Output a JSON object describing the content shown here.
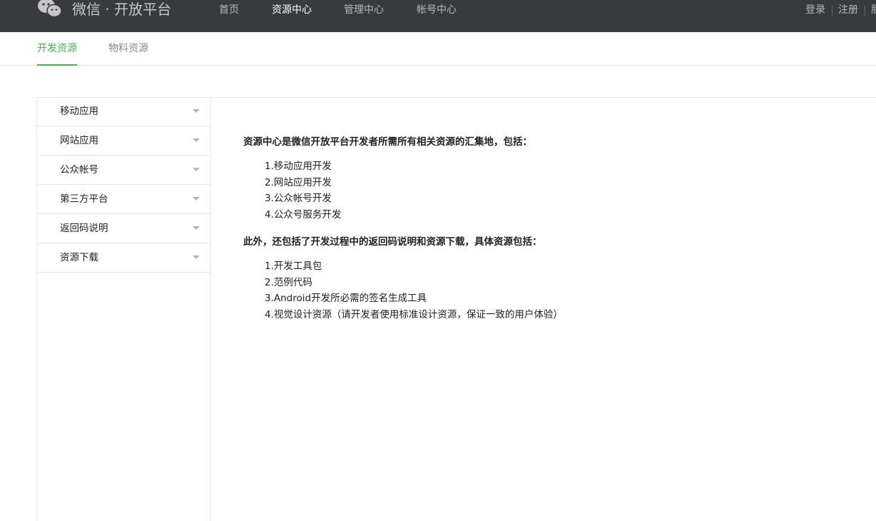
{
  "header": {
    "brand": "微信 · 开放平台",
    "nav": [
      "首页",
      "资源中心",
      "管理中心",
      "帐号中心"
    ],
    "active_nav": "资源中心",
    "login": "登录",
    "register": "注册",
    "extra": "服"
  },
  "subnav": {
    "tabs": [
      "开发资源",
      "物料资源"
    ],
    "active_tab": "开发资源"
  },
  "sidebar": {
    "items": [
      {
        "label": "移动应用"
      },
      {
        "label": "网站应用"
      },
      {
        "label": "公众帐号"
      },
      {
        "label": "第三方平台"
      },
      {
        "label": "返回码说明"
      },
      {
        "label": "资源下载"
      }
    ]
  },
  "main": {
    "intro": "资源中心是微信开放平台开发者所需所有相关资源的汇集地，包括：",
    "list1": [
      "1.移动应用开发",
      "2.网站应用开发",
      "3.公众帐号开发",
      "4.公众号服务开发"
    ],
    "extra": "此外，还包括了开发过程中的返回码说明和资源下载，具体资源包括：",
    "list2": [
      "1.开发工具包",
      "2.范例代码",
      "3.Android开发所必需的签名生成工具",
      "4.视觉设计资源（请开发者使用标准设计资源，保证一致的用户体验）"
    ]
  },
  "colors": {
    "topbar_bg": "#393a3e",
    "accent": "#44b549",
    "border": "#e7e7e7"
  },
  "icons": {
    "logo": "wechat-logo-icon",
    "caret": "caret-down-icon"
  }
}
